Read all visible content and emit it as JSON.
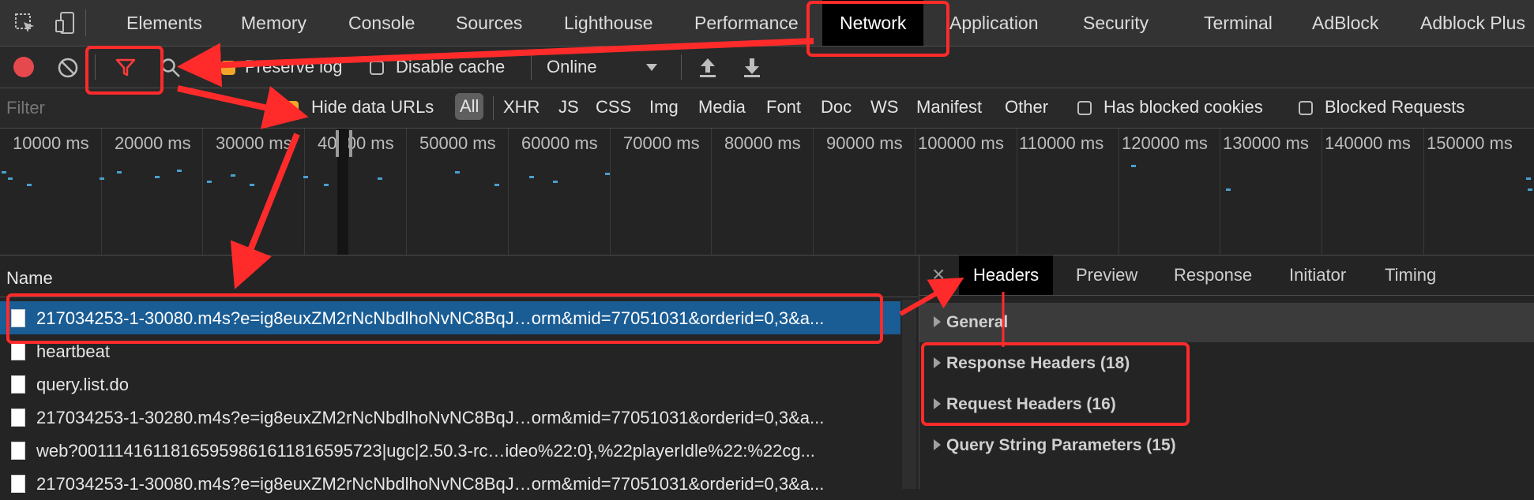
{
  "top_tabs": [
    "Elements",
    "Memory",
    "Console",
    "Sources",
    "Lighthouse",
    "Performance",
    "Network",
    "Application",
    "Security",
    "Terminal",
    "AdBlock",
    "Adblock Plus"
  ],
  "active_tab": "Network",
  "toolbar": {
    "preserve_log": "Preserve log",
    "disable_cache": "Disable cache",
    "throttle": "Online"
  },
  "filter_bar": {
    "placeholder": "Filter",
    "hide_data_urls": "Hide data URLs",
    "all": "All",
    "types": [
      "XHR",
      "JS",
      "CSS",
      "Img",
      "Media",
      "Font",
      "Doc",
      "WS",
      "Manifest",
      "Other"
    ],
    "has_blocked_cookies": "Has blocked cookies",
    "blocked_requests": "Blocked Requests"
  },
  "timeline_ticks": [
    "10000 ms",
    "20000 ms",
    "30000 ms",
    "40000 ms",
    "50000 ms",
    "60000 ms",
    "70000 ms",
    "80000 ms",
    "90000 ms",
    "100000 ms",
    "110000 ms",
    "120000 ms",
    "130000 ms",
    "140000 ms",
    "150000 ms"
  ],
  "request_list": {
    "header": "Name",
    "rows": [
      "217034253-1-30080.m4s?e=ig8euxZM2rNcNbdlhoNvNC8BqJ…orm&mid=77051031&orderid=0,3&a...",
      "heartbeat",
      "query.list.do",
      "217034253-1-30280.m4s?e=ig8euxZM2rNcNbdlhoNvNC8BqJ…orm&mid=77051031&orderid=0,3&a...",
      "web?0011141611816595986161181659​5723|ugc|2.50.3-rc…ideo%22:0},%22playerIdle%22:%22cg...",
      "217034253-1-30080.m4s?e=ig8euxZM2rNcNbdlhoNvNC8BqJ…orm&mid=77051031&orderid=0,3&a..."
    ]
  },
  "details": {
    "close": "×",
    "tabs": [
      "Headers",
      "Preview",
      "Response",
      "Initiator",
      "Timing"
    ],
    "sections": [
      "General",
      "Response Headers (18)",
      "Request Headers (16)",
      "Query String Parameters (15)"
    ]
  },
  "colors": {
    "annotation": "#ff2b2b",
    "selected_row": "#1a5c94",
    "record": "#e5484d",
    "filter_icon": "#ff3b3b"
  }
}
